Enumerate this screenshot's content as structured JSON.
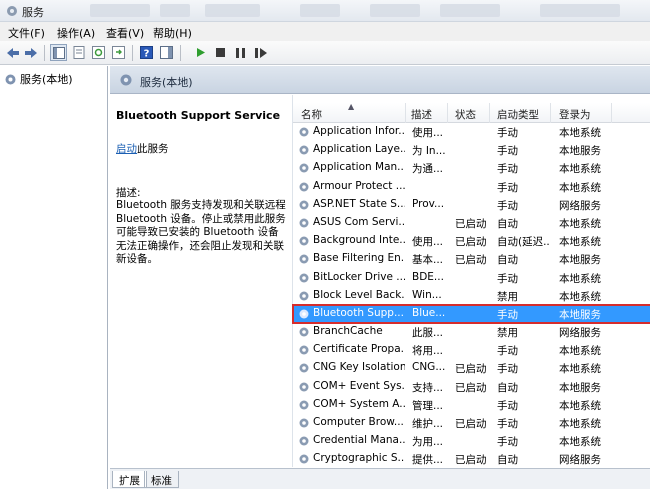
{
  "window": {
    "title": "服务"
  },
  "menu": [
    "文件(F)",
    "操作(A)",
    "查看(V)",
    "帮助(H)"
  ],
  "tree": {
    "root_label": "服务(本地)"
  },
  "panel_header": {
    "title": "服务(本地)"
  },
  "details": {
    "service_name": "Bluetooth Support Service",
    "start_link": "启动",
    "start_suffix": "此服务",
    "description_label": "描述:",
    "description": "Bluetooth 服务支持发现和关联远程 Bluetooth 设备。停止或禁用此服务可能导致已安装的 Bluetooth 设备无法正确操作，还会阻止发现和关联新设备。"
  },
  "columns": {
    "name": "名称",
    "description": "描述",
    "status": "状态",
    "startup": "启动类型",
    "logon": "登录为"
  },
  "services": [
    {
      "name": "Application Infor...",
      "desc": "使用...",
      "status": "",
      "startup": "手动",
      "logon": "本地系统"
    },
    {
      "name": "Application Laye...",
      "desc": "为 In...",
      "status": "",
      "startup": "手动",
      "logon": "本地服务"
    },
    {
      "name": "Application Man...",
      "desc": "为通...",
      "status": "",
      "startup": "手动",
      "logon": "本地系统"
    },
    {
      "name": "Armour Protect ...",
      "desc": "",
      "status": "",
      "startup": "手动",
      "logon": "本地系统"
    },
    {
      "name": "ASP.NET State S...",
      "desc": "Prov...",
      "status": "",
      "startup": "手动",
      "logon": "网络服务"
    },
    {
      "name": "ASUS Com Servi...",
      "desc": "",
      "status": "已启动",
      "startup": "自动",
      "logon": "本地系统"
    },
    {
      "name": "Background Inte...",
      "desc": "使用...",
      "status": "已启动",
      "startup": "自动(延迟...",
      "logon": "本地系统"
    },
    {
      "name": "Base Filtering En...",
      "desc": "基本...",
      "status": "已启动",
      "startup": "自动",
      "logon": "本地服务"
    },
    {
      "name": "BitLocker Drive ...",
      "desc": "BDE...",
      "status": "",
      "startup": "手动",
      "logon": "本地系统"
    },
    {
      "name": "Block Level Back...",
      "desc": "Win...",
      "status": "",
      "startup": "禁用",
      "logon": "本地系统"
    },
    {
      "name": "Bluetooth Supp...",
      "desc": "Blue...",
      "status": "",
      "startup": "手动",
      "logon": "本地服务",
      "selected": true
    },
    {
      "name": "BranchCache",
      "desc": "此服...",
      "status": "",
      "startup": "禁用",
      "logon": "网络服务"
    },
    {
      "name": "Certificate Propa...",
      "desc": "将用...",
      "status": "",
      "startup": "手动",
      "logon": "本地系统"
    },
    {
      "name": "CNG Key Isolation",
      "desc": "CNG...",
      "status": "已启动",
      "startup": "手动",
      "logon": "本地系统"
    },
    {
      "name": "COM+ Event Sys...",
      "desc": "支持...",
      "status": "已启动",
      "startup": "自动",
      "logon": "本地服务"
    },
    {
      "name": "COM+ System A...",
      "desc": "管理...",
      "status": "",
      "startup": "手动",
      "logon": "本地系统"
    },
    {
      "name": "Computer Brow...",
      "desc": "维护...",
      "status": "已启动",
      "startup": "手动",
      "logon": "本地系统"
    },
    {
      "name": "Credential Mana...",
      "desc": "为用...",
      "status": "",
      "startup": "手动",
      "logon": "本地系统"
    },
    {
      "name": "Cryptographic S...",
      "desc": "提供...",
      "status": "已启动",
      "startup": "自动",
      "logon": "网络服务"
    }
  ],
  "tabs": [
    "扩展",
    "标准"
  ],
  "colors": {
    "selection": "#3399ff",
    "highlight_border": "#d62d2d",
    "link": "#1b5fb3"
  }
}
